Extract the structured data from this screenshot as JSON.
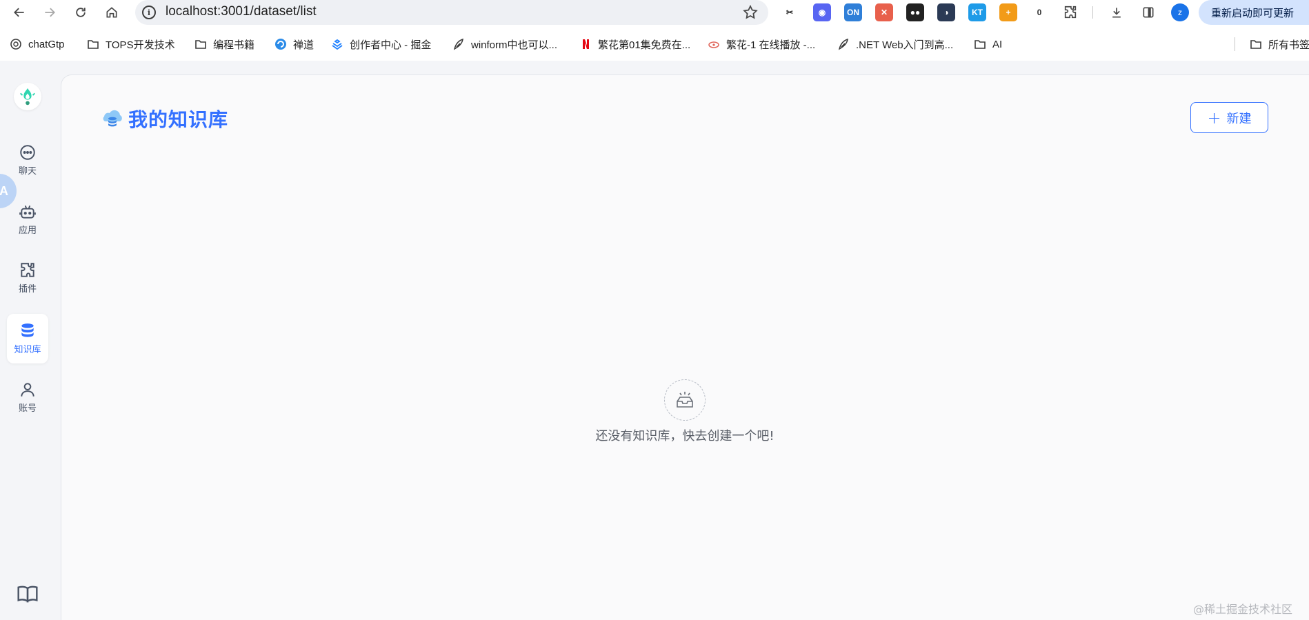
{
  "browser": {
    "url": "localhost:3001/dataset/list",
    "update_button": "重新启动即可更新",
    "profile_initial": "z",
    "extensions": [
      {
        "name": "cut-extension-icon",
        "label": "✂",
        "color": "#222222",
        "bg": "#ffffff"
      },
      {
        "name": "discord-extension-icon",
        "label": "◉",
        "color": "#ffffff",
        "bg": "#5865f2"
      },
      {
        "name": "on-extension-icon",
        "label": "ON",
        "color": "#ffffff",
        "bg": "#2f7fd8"
      },
      {
        "name": "colorful-extension-icon",
        "label": "✕",
        "color": "#ffffff",
        "bg": "#e8604c"
      },
      {
        "name": "dark-extension-icon",
        "label": "●●",
        "color": "#ffffff",
        "bg": "#222222"
      },
      {
        "name": "edge-extension-icon",
        "label": "◑",
        "color": "#ffffff",
        "bg": "#2b3a55"
      },
      {
        "name": "kt-extension-icon",
        "label": "KT",
        "color": "#ffffff",
        "bg": "#1e9be8"
      },
      {
        "name": "plus-extension-icon",
        "label": "+",
        "color": "#ffffff",
        "bg": "#f29b18"
      },
      {
        "name": "counter-extension-icon",
        "label": "0",
        "color": "#333333",
        "bg": "#ffffff"
      },
      {
        "name": "puzzle-extension-icon",
        "label": "",
        "color": "#474747",
        "bg": "#ffffff"
      }
    ]
  },
  "bookmarks": [
    {
      "label": "chatGtp",
      "icon": "openai-icon"
    },
    {
      "label": "TOPS开发技术",
      "icon": "folder-icon"
    },
    {
      "label": "编程书籍",
      "icon": "folder-icon"
    },
    {
      "label": "禅道",
      "icon": "zentao-icon"
    },
    {
      "label": "创作者中心 - 掘金",
      "icon": "juejin-icon"
    },
    {
      "label": "winform中也可以...",
      "icon": "feather-icon"
    },
    {
      "label": "繁花第01集免费在...",
      "icon": "netflix-icon"
    },
    {
      "label": "繁花-1 在线播放 -...",
      "icon": "video-icon"
    },
    {
      "label": ".NET Web入门到高...",
      "icon": "feather-icon"
    },
    {
      "label": "AI",
      "icon": "folder-icon"
    },
    {
      "label": "所有书签",
      "icon": "folder-icon"
    }
  ],
  "sidebar": {
    "items": [
      {
        "label": "聊天",
        "icon": "chat-icon",
        "active": false
      },
      {
        "label": "应用",
        "icon": "robot-icon",
        "active": false
      },
      {
        "label": "插件",
        "icon": "puzzle-icon",
        "active": false
      },
      {
        "label": "知识库",
        "icon": "database-icon",
        "active": true
      },
      {
        "label": "账号",
        "icon": "user-icon",
        "active": false
      }
    ],
    "translate_badge": "A"
  },
  "main": {
    "title": "我的知识库",
    "new_button": "新建",
    "empty_text": "还没有知识库，快去创建一个吧!"
  },
  "watermark": "@稀土掘金技术社区",
  "colors": {
    "accent": "#3370ff",
    "app_bg": "#f4f5f8",
    "panel_bg": "#fafafb"
  }
}
